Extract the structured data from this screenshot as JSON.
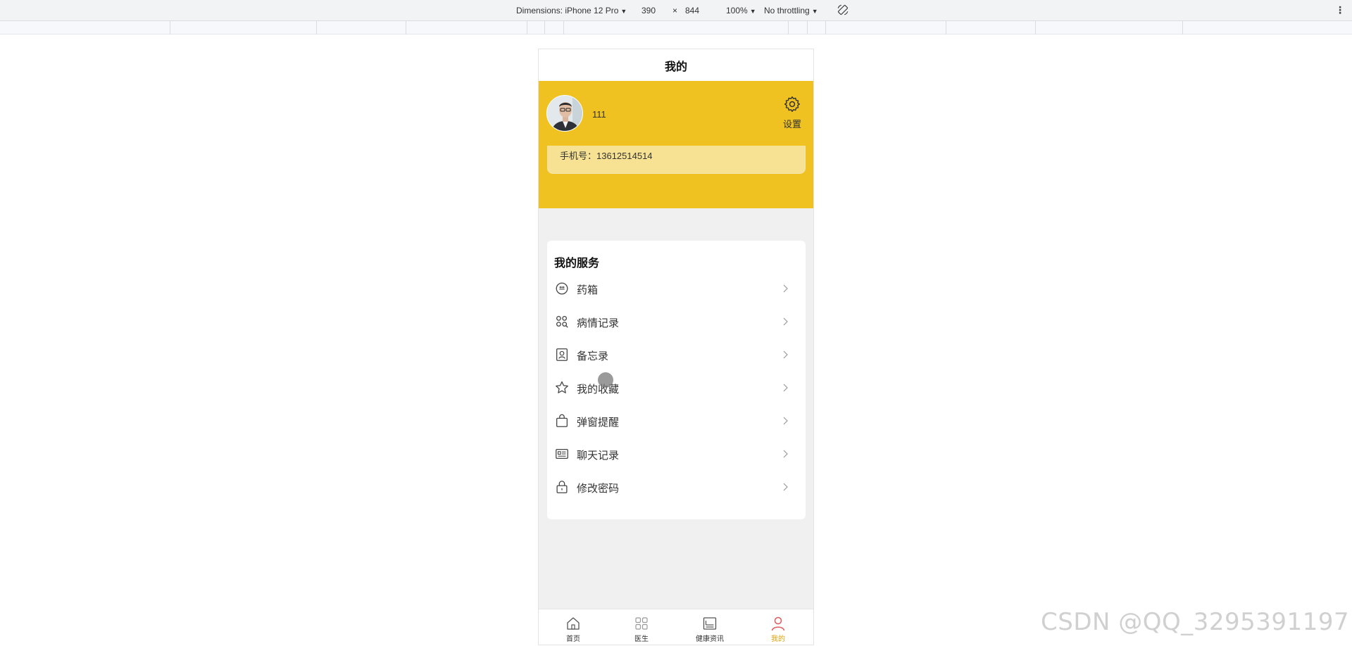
{
  "devtools": {
    "dimensions_label": "Dimensions: iPhone 12 Pro",
    "width": "390",
    "times": "×",
    "height": "844",
    "zoom": "100%",
    "throttling": "No throttling",
    "rotate_icon": "rotate-icon",
    "more_icon": "kebab-icon"
  },
  "page": {
    "title": "我的"
  },
  "profile": {
    "username": "111",
    "settings_label": "设置",
    "phone_text": "手机号：13612514514",
    "hero_color": "#efc222",
    "card_color": "#f6e292"
  },
  "services": {
    "title": "我的服务",
    "items": [
      {
        "label": "药箱",
        "icon": "medicine-box-icon"
      },
      {
        "label": "病情记录",
        "icon": "condition-record-icon"
      },
      {
        "label": "备忘录",
        "icon": "memo-icon"
      },
      {
        "label": "我的收藏",
        "icon": "star-icon"
      },
      {
        "label": "弹窗提醒",
        "icon": "bag-icon"
      },
      {
        "label": "聊天记录",
        "icon": "chat-record-icon"
      },
      {
        "label": "修改密码",
        "icon": "lock-icon"
      }
    ]
  },
  "tabbar": {
    "active_color": "#e0a10a",
    "items": [
      {
        "label": "首页",
        "icon": "home-icon"
      },
      {
        "label": "医生",
        "icon": "grid-icon"
      },
      {
        "label": "健康资讯",
        "icon": "news-icon"
      },
      {
        "label": "我的",
        "icon": "user-icon"
      }
    ]
  },
  "watermark": "CSDN @QQ_3295391197"
}
